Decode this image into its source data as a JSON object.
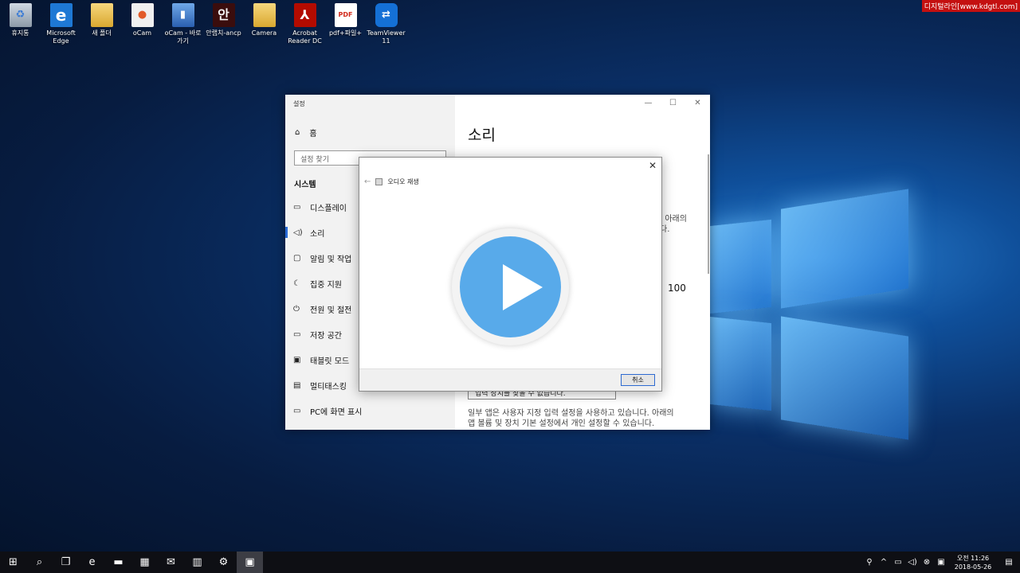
{
  "watermark": "디지털라인[www.kdgtl.com]",
  "desktop_icons": [
    {
      "label": "휴지통",
      "icon": "recycle-bin-icon",
      "glyph": "♻"
    },
    {
      "label": "Microsoft Edge",
      "icon": "edge-icon",
      "glyph": "e"
    },
    {
      "label": "새 폴더",
      "icon": "folder-icon",
      "glyph": ""
    },
    {
      "label": "oCam",
      "icon": "ocam-icon",
      "glyph": "●"
    },
    {
      "label": "oCam - 바로 가기",
      "icon": "ocam-shortcut-icon",
      "glyph": "▮"
    },
    {
      "label": "안랩치-ancp",
      "icon": "an-icon",
      "glyph": "안"
    },
    {
      "label": "Camera",
      "icon": "camera-folder-icon",
      "glyph": ""
    },
    {
      "label": "Acrobat Reader DC",
      "icon": "acrobat-icon",
      "glyph": "⅄"
    },
    {
      "label": "pdf+파일+",
      "icon": "pdf-file-icon",
      "glyph": "PDF"
    },
    {
      "label": "TeamViewer 11",
      "icon": "teamviewer-icon",
      "glyph": "⇄"
    }
  ],
  "settings": {
    "window_title": "설정",
    "controls": {
      "minimize": "—",
      "maximize": "☐",
      "close": "✕"
    },
    "home_icon": "⌂",
    "home_label": "홈",
    "search_placeholder": "설정 찾기",
    "section": "시스템",
    "nav": [
      {
        "icon": "▭",
        "label": "디스플레이",
        "active": false
      },
      {
        "icon": "◁)",
        "label": "소리",
        "active": true
      },
      {
        "icon": "▢",
        "label": "알림 및 작업",
        "active": false
      },
      {
        "icon": "☾",
        "label": "집중 지원",
        "active": false
      },
      {
        "icon": "⏻",
        "label": "전원 및 절전",
        "active": false
      },
      {
        "icon": "▭",
        "label": "저장 공간",
        "active": false
      },
      {
        "icon": "▣",
        "label": "태블릿 모드",
        "active": false
      },
      {
        "icon": "▤",
        "label": "멀티태스킹",
        "active": false
      },
      {
        "icon": "▭",
        "label": "PC에 화면 표시",
        "active": false
      }
    ],
    "main_title": "소리",
    "bg_text_1": ". 아래의",
    "bg_text_2": "다.",
    "bg_volume": "100",
    "bg_select": "입력 장치를 찾을 수 없습니다.",
    "bg_text_3": "일부 앱은 사용자 지정 입력 설정을 사용하고 있습니다. 아래의",
    "bg_text_4": "앱 볼륨 및 장치 기본 설정에서 개인 설정할 수 있습니다."
  },
  "dialog": {
    "close": "✕",
    "back": "←",
    "title": "오디오 재생",
    "cancel_label": "취소"
  },
  "taskbar": {
    "start": "⊞",
    "search": "⌕",
    "task_view": "❐",
    "apps": [
      {
        "name": "edge",
        "glyph": "e",
        "active": false
      },
      {
        "name": "explorer",
        "glyph": "▬",
        "active": false
      },
      {
        "name": "store",
        "glyph": "▦",
        "active": false
      },
      {
        "name": "mail",
        "glyph": "✉",
        "active": false
      },
      {
        "name": "chart-app",
        "glyph": "▥",
        "active": false
      },
      {
        "name": "settings",
        "glyph": "⚙",
        "active": false
      },
      {
        "name": "audio-window",
        "glyph": "▣",
        "active": true
      }
    ],
    "tray": [
      "⚲",
      "^",
      "▭",
      "◁)",
      "⊗",
      "▣"
    ],
    "time": "오전 11:26",
    "date": "2018-05-26",
    "notification": "▤"
  }
}
